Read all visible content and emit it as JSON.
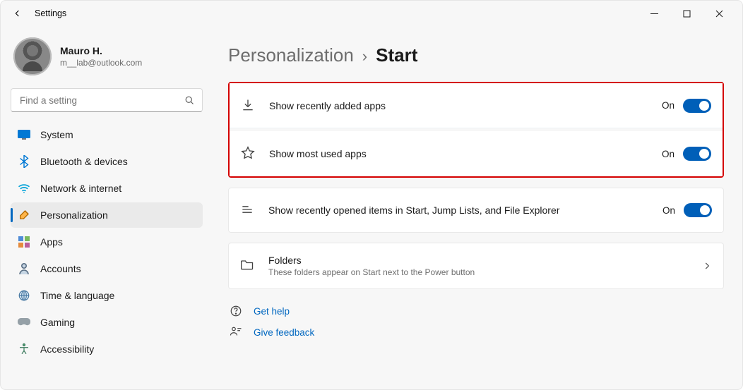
{
  "window": {
    "title": "Settings"
  },
  "profile": {
    "name": "Mauro H.",
    "email": "m__lab@outlook.com"
  },
  "search": {
    "placeholder": "Find a setting"
  },
  "nav": {
    "items": [
      {
        "label": "System"
      },
      {
        "label": "Bluetooth & devices"
      },
      {
        "label": "Network & internet"
      },
      {
        "label": "Personalization"
      },
      {
        "label": "Apps"
      },
      {
        "label": "Accounts"
      },
      {
        "label": "Time & language"
      },
      {
        "label": "Gaming"
      },
      {
        "label": "Accessibility"
      }
    ]
  },
  "breadcrumb": {
    "parent": "Personalization",
    "sep": "›",
    "current": "Start"
  },
  "cards": {
    "recent_apps": {
      "label": "Show recently added apps",
      "state": "On"
    },
    "most_used": {
      "label": "Show most used apps",
      "state": "On"
    },
    "recent_items": {
      "label": "Show recently opened items in Start, Jump Lists, and File Explorer",
      "state": "On"
    },
    "folders": {
      "label": "Folders",
      "sub": "These folders appear on Start next to the Power button"
    }
  },
  "links": {
    "help": "Get help",
    "feedback": "Give feedback"
  }
}
